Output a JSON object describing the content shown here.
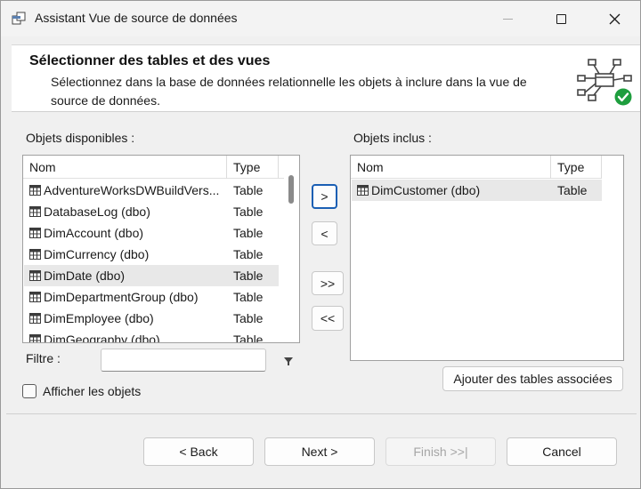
{
  "window": {
    "title": "Assistant Vue de source de données"
  },
  "header": {
    "title": "Sélectionner des tables et des vues",
    "description": "Sélectionnez dans la base de données relationnelle les objets à inclure dans la vue de source de données."
  },
  "available": {
    "label": "Objets disponibles :",
    "columns": {
      "name": "Nom",
      "type": "Type"
    },
    "rows": [
      {
        "name": "AdventureWorksDWBuildVers...",
        "type": "Table"
      },
      {
        "name": "DatabaseLog (dbo)",
        "type": "Table"
      },
      {
        "name": "DimAccount (dbo)",
        "type": "Table"
      },
      {
        "name": "DimCurrency (dbo)",
        "type": "Table"
      },
      {
        "name": "DimDate (dbo)",
        "type": "Table"
      },
      {
        "name": "DimDepartmentGroup (dbo)",
        "type": "Table"
      },
      {
        "name": "DimEmployee (dbo)",
        "type": "Table"
      },
      {
        "name": "DimGeography (dbo)",
        "type": "Table"
      }
    ],
    "selected_index": 4
  },
  "included": {
    "label": "Objets inclus :",
    "columns": {
      "name": "Nom",
      "type": "Type"
    },
    "rows": [
      {
        "name": "DimCustomer (dbo)",
        "type": "Table"
      }
    ]
  },
  "move_buttons": {
    "add": ">",
    "remove": "<",
    "add_all": ">>",
    "remove_all": "<<"
  },
  "filter": {
    "label": "Filtre :",
    "value": ""
  },
  "show_objects": {
    "label": "Afficher les objets",
    "checked": false
  },
  "related_tables_button": "Ajouter des tables associées",
  "footer": {
    "back": "< Back",
    "next": "Next >",
    "finish": "Finish >>|",
    "cancel": "Cancel"
  },
  "colors": {
    "accent": "#1a5fb4",
    "check_green": "#1e9e3e",
    "selected_row": "#e8e8e8"
  }
}
